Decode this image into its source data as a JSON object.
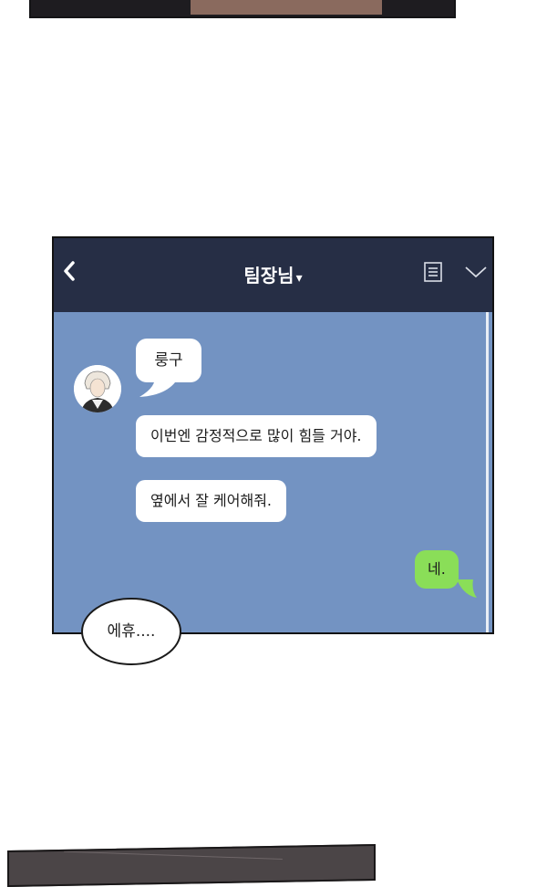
{
  "chat": {
    "title": "팀장님",
    "title_arrow": "▾",
    "icons": {
      "back": "back-chevron-icon",
      "menu": "menu-list-icon",
      "collapse": "chevron-down-icon"
    },
    "colors": {
      "header": "#262e45",
      "background": "#7393c2",
      "incoming_bubble": "#ffffff",
      "outgoing_bubble": "#8ade58"
    },
    "sender_name": "룽구",
    "messages": [
      {
        "from": "other",
        "text": "이번엔 감정적으로 많이 힘들 거야."
      },
      {
        "from": "other",
        "text": "옆에서 잘 케어해줘."
      },
      {
        "from": "me",
        "text": "네."
      }
    ]
  },
  "speech_bubble": {
    "text": "에휴...."
  }
}
